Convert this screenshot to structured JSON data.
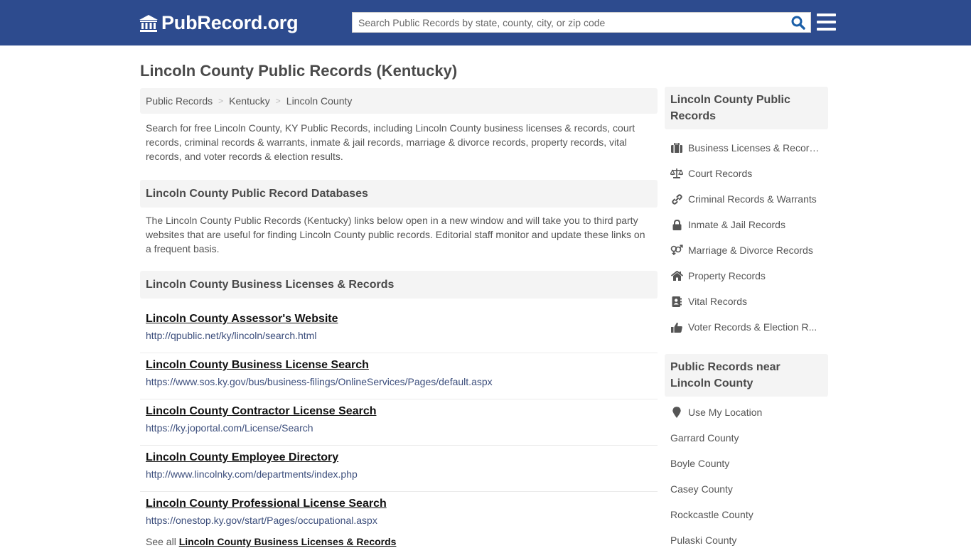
{
  "header": {
    "logo_text": "PubRecord.org",
    "search_placeholder": "Search Public Records by state, county, city, or zip code",
    "brand_color": "#2d4b8e",
    "search_icon_color": "#1b5fa8"
  },
  "page": {
    "title": "Lincoln County Public Records (Kentucky)"
  },
  "breadcrumb": [
    {
      "label": "Public Records"
    },
    {
      "label": "Kentucky"
    },
    {
      "label": "Lincoln County"
    }
  ],
  "breadcrumb_separator": ">",
  "intro": "Search for free Lincoln County, KY Public Records, including Lincoln County business licenses & records, court records, criminal records & warrants, inmate & jail records, marriage & divorce records, property records, vital records, and voter records & election results.",
  "databases": {
    "heading": "Lincoln County Public Record Databases",
    "text": "The Lincoln County Public Records (Kentucky) links below open in a new window and will take you to third party websites that are useful for finding Lincoln County public records. Editorial staff monitor and update these links on a frequent basis."
  },
  "business": {
    "heading": "Lincoln County Business Licenses & Records",
    "links": [
      {
        "title": "Lincoln County Assessor's Website",
        "url": "http://qpublic.net/ky/lincoln/search.html"
      },
      {
        "title": "Lincoln County Business License Search",
        "url": "https://www.sos.ky.gov/bus/business-filings/OnlineServices/Pages/default.aspx"
      },
      {
        "title": "Lincoln County Contractor License Search",
        "url": "https://ky.joportal.com/License/Search"
      },
      {
        "title": "Lincoln County Employee Directory",
        "url": "http://www.lincolnky.com/departments/index.php"
      },
      {
        "title": "Lincoln County Professional License Search",
        "url": "https://onestop.ky.gov/start/Pages/occupational.aspx"
      }
    ],
    "see_all_prefix": "See all",
    "see_all_link": "Lincoln County Business Licenses & Records"
  },
  "sidebar": {
    "records_heading": "Lincoln County Public Records",
    "records_items": [
      {
        "label": "Business Licenses & Records",
        "icon": "briefcase-icon"
      },
      {
        "label": "Court Records",
        "icon": "balance-scale-icon"
      },
      {
        "label": "Criminal Records & Warrants",
        "icon": "link-icon"
      },
      {
        "label": "Inmate & Jail Records",
        "icon": "lock-icon"
      },
      {
        "label": "Marriage & Divorce Records",
        "icon": "venus-mars-icon"
      },
      {
        "label": "Property Records",
        "icon": "home-icon"
      },
      {
        "label": "Vital Records",
        "icon": "address-book-icon"
      },
      {
        "label": "Voter Records & Election R...",
        "icon": "thumbs-up-icon"
      }
    ],
    "near_heading": "Public Records near Lincoln County",
    "use_location": "Use My Location",
    "near_items": [
      {
        "label": "Garrard County"
      },
      {
        "label": "Boyle County"
      },
      {
        "label": "Casey County"
      },
      {
        "label": "Rockcastle County"
      },
      {
        "label": "Pulaski County"
      }
    ]
  }
}
